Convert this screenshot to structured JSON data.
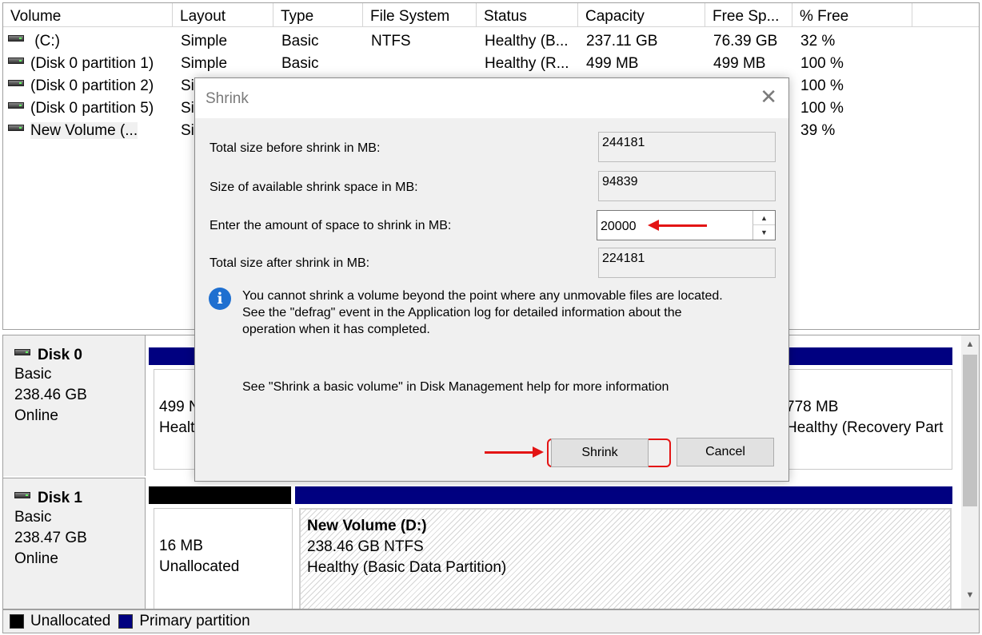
{
  "volume_list": {
    "columns": [
      "Volume",
      "Layout",
      "Type",
      "File System",
      "Status",
      "Capacity",
      "Free Sp...",
      "% Free"
    ],
    "rows": [
      {
        "volume": " (C:)",
        "layout": "Simple",
        "type": "Basic",
        "fs": "NTFS",
        "status": "Healthy (B...",
        "capacity": "237.11 GB",
        "free": "76.39 GB",
        "pct": "32 %"
      },
      {
        "volume": "(Disk 0 partition 1)",
        "layout": "Simple",
        "type": "Basic",
        "fs": "",
        "status": "Healthy (R...",
        "capacity": "499 MB",
        "free": "499 MB",
        "pct": "100 %"
      },
      {
        "volume": "(Disk 0 partition 2)",
        "layout": "Si",
        "type": "",
        "fs": "",
        "status": "",
        "capacity": "",
        "free": "",
        "pct": "100 %"
      },
      {
        "volume": "(Disk 0 partition 5)",
        "layout": "Si",
        "type": "",
        "fs": "",
        "status": "",
        "capacity": "",
        "free": "",
        "pct": "100 %"
      },
      {
        "volume": "New Volume (...",
        "layout": "Si",
        "type": "",
        "fs": "",
        "status": "",
        "capacity": "",
        "free": "",
        "pct": "39 %"
      }
    ]
  },
  "disk_map": {
    "disks": [
      {
        "name": "Disk 0",
        "type": "Basic",
        "size": "238.46 GB",
        "state": "Online",
        "part_left": {
          "line1": "499 N",
          "line2": "Healt"
        },
        "part_right": {
          "line1": "778 MB",
          "line2": "Healthy (Recovery Part"
        }
      },
      {
        "name": "Disk 1",
        "type": "Basic",
        "size": "238.47 GB",
        "state": "Online",
        "part_unalloc": {
          "line1": "16 MB",
          "line2": "Unallocated"
        },
        "part_volume": {
          "line1": "New Volume  (D:)",
          "line2": "238.46 GB NTFS",
          "line3": "Healthy (Basic Data Partition)"
        }
      }
    ]
  },
  "legend": {
    "unallocated": "Unallocated",
    "primary": "Primary partition",
    "unallocated_color": "#000000",
    "primary_color": "#000080"
  },
  "dialog": {
    "title": "Shrink",
    "close_symbol": "✕",
    "total_before_label": "Total size before shrink in MB:",
    "total_before_value": "244181",
    "available_label": "Size of available shrink space in MB:",
    "available_value": "94839",
    "enter_label": "Enter the amount of space to shrink in MB:",
    "enter_value": "20000",
    "total_after_label": "Total size after shrink in MB:",
    "total_after_value": "224181",
    "info_line1": "You cannot shrink a volume beyond the point where any unmovable files are located.",
    "info_line2": "See the \"defrag\" event in the Application log for detailed information about the",
    "info_line3": "operation when it has completed.",
    "help_text": "See \"Shrink a basic volume\" in Disk Management help for more information",
    "shrink_label": "Shrink",
    "cancel_label": "Cancel"
  },
  "icons": {
    "drive": "drive-icon",
    "info": "info-icon",
    "close": "close-icon"
  },
  "accent_color": "#e31414"
}
